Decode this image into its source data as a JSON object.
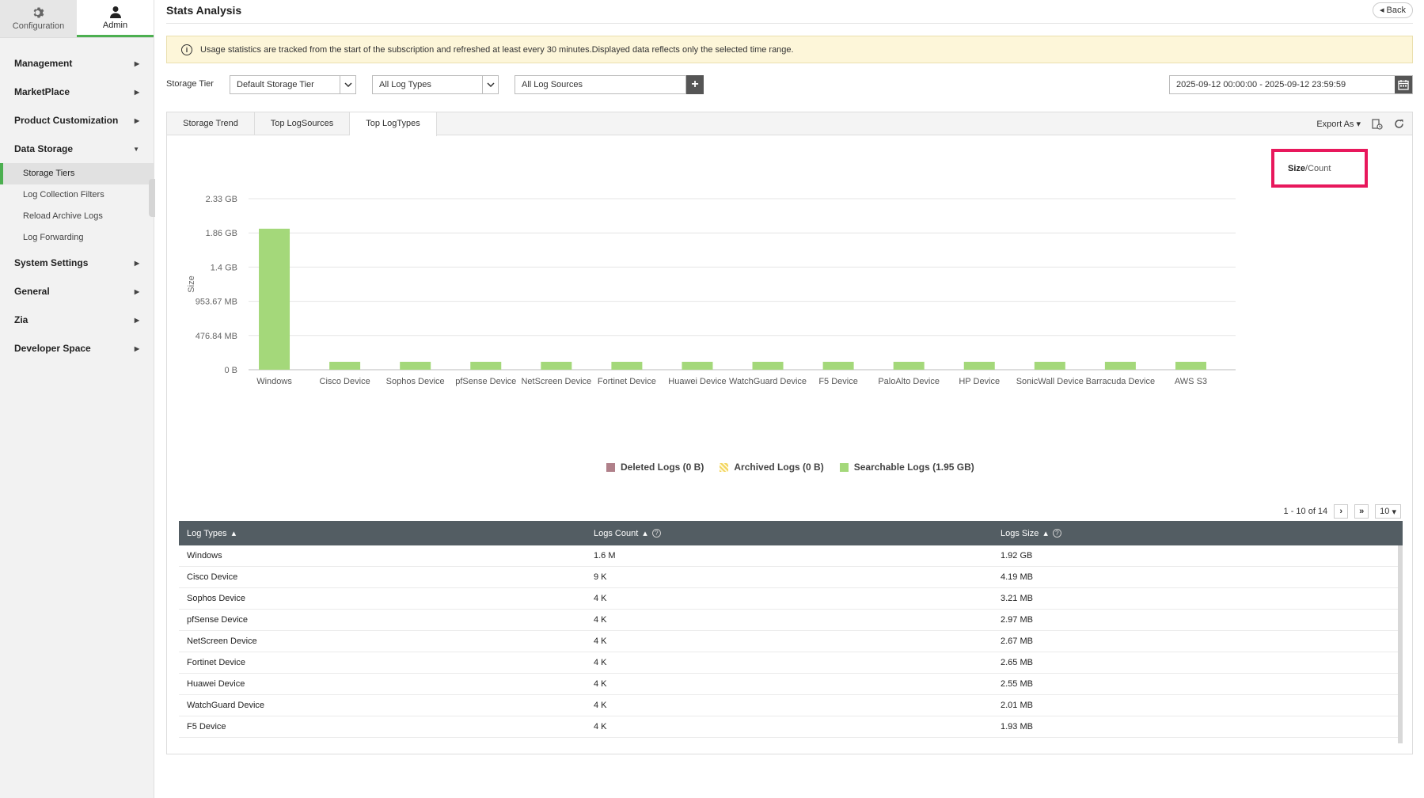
{
  "topnav": [
    {
      "label": "Configuration",
      "icon": "gear-icon",
      "active": false
    },
    {
      "label": "Admin",
      "icon": "user-icon",
      "active": true
    }
  ],
  "sidebar": {
    "items": [
      {
        "label": "Management",
        "expanded": false
      },
      {
        "label": "MarketPlace",
        "expanded": false
      },
      {
        "label": "Product Customization",
        "expanded": false
      },
      {
        "label": "Data Storage",
        "expanded": true,
        "children": [
          "Storage Tiers",
          "Log Collection Filters",
          "Reload Archive Logs",
          "Log Forwarding"
        ],
        "active_child": "Storage Tiers"
      },
      {
        "label": "System Settings",
        "expanded": false
      },
      {
        "label": "General",
        "expanded": false
      },
      {
        "label": "Zia",
        "expanded": false
      },
      {
        "label": "Developer Space",
        "expanded": false
      }
    ]
  },
  "header": {
    "title": "Stats Analysis",
    "back_label": "Back"
  },
  "banner": {
    "text": "Usage statistics are tracked from the start of the subscription and refreshed at least every 30 minutes.Displayed data reflects only the selected time range."
  },
  "filters": {
    "storage_tier_label": "Storage Tier",
    "storage_tier_value": "Default Storage Tier",
    "log_types_value": "All Log Types",
    "log_sources_value": "All Log Sources",
    "date_range": "2025-09-12 00:00:00 - 2025-09-12 23:59:59"
  },
  "tabs": [
    {
      "label": "Storage Trend",
      "active": false
    },
    {
      "label": "Top LogSources",
      "active": false
    },
    {
      "label": "Top LogTypes",
      "active": true
    }
  ],
  "toolbar": {
    "export_label": "Export As"
  },
  "toggle": {
    "size": "Size",
    "sep": " / ",
    "count": "Count"
  },
  "chart_data": {
    "type": "bar",
    "categories": [
      "Windows",
      "Cisco Device",
      "Sophos Device",
      "pfSense Device",
      "NetScreen Device",
      "Fortinet Device",
      "Huawei Device",
      "WatchGuard Device",
      "F5 Device",
      "PaloAlto Device",
      "HP Device",
      "SonicWall Device",
      "Barracuda Device",
      "AWS S3"
    ],
    "series": [
      {
        "name": "Searchable Logs (1.95 GB)",
        "values_mb": [
          1966.08,
          4.19,
          3.21,
          2.97,
          2.67,
          2.65,
          2.55,
          2.01,
          1.93,
          1.8,
          1.7,
          1.6,
          1.5,
          1.4
        ],
        "color": "#a4d87a"
      }
    ],
    "ylabel": "Size",
    "yticks": [
      "0 B",
      "476.84 MB",
      "953.67 MB",
      "1.4 GB",
      "1.86 GB",
      "2.33 GB"
    ],
    "ylim_mb": [
      0,
      2384.19
    ],
    "legend": [
      {
        "label": "Deleted Logs (0 B)",
        "color": "#b0808a",
        "pattern": false
      },
      {
        "label": "Archived Logs (0 B)",
        "color": "#f2d45c",
        "pattern": true
      },
      {
        "label": "Searchable Logs (1.95 GB)",
        "color": "#a4d87a",
        "pattern": false
      }
    ],
    "legend_position": "bottom-center"
  },
  "pager": {
    "range": "1 - 10 of 14",
    "page_size": "10"
  },
  "table": {
    "headers": [
      "Log Types",
      "Logs Count",
      "Logs Size"
    ],
    "rows": [
      [
        "Windows",
        "1.6 M",
        "1.92 GB"
      ],
      [
        "Cisco Device",
        "9 K",
        "4.19 MB"
      ],
      [
        "Sophos Device",
        "4 K",
        "3.21 MB"
      ],
      [
        "pfSense Device",
        "4 K",
        "2.97 MB"
      ],
      [
        "NetScreen Device",
        "4 K",
        "2.67 MB"
      ],
      [
        "Fortinet Device",
        "4 K",
        "2.65 MB"
      ],
      [
        "Huawei Device",
        "4 K",
        "2.55 MB"
      ],
      [
        "WatchGuard Device",
        "4 K",
        "2.01 MB"
      ],
      [
        "F5 Device",
        "4 K",
        "1.93 MB"
      ]
    ]
  }
}
